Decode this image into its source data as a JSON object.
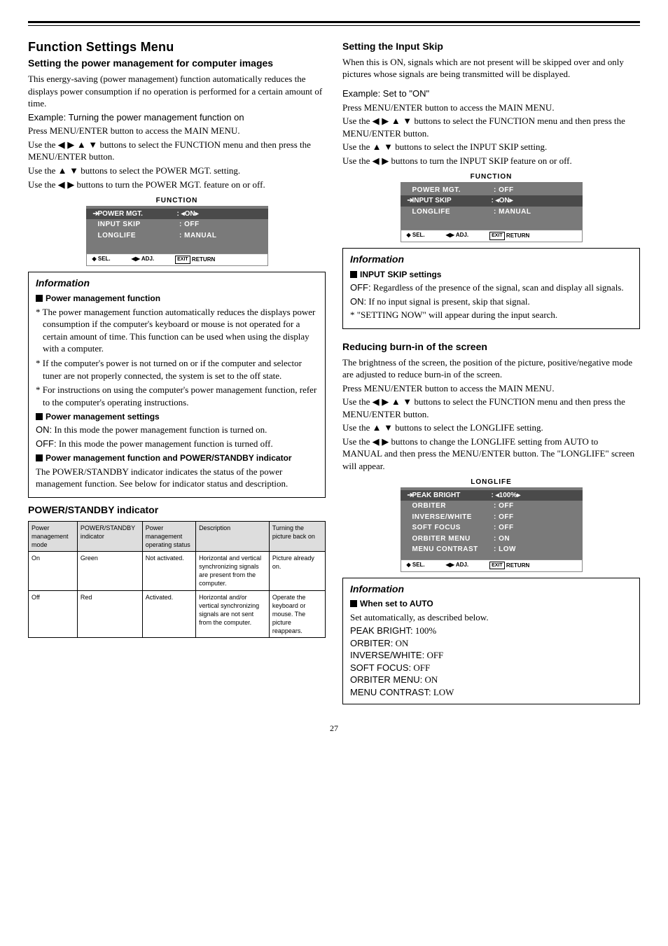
{
  "pageNumber": "27",
  "left": {
    "h1": "Function Settings Menu",
    "h2a": "Setting the power management for computer images",
    "p1": "This energy-saving (power management) function automatically reduces the displays power consumption if no operation is performed for a certain amount of time.",
    "ex1": "Example: Turning the power management function on",
    "p2": "Press MENU/ENTER button to access the MAIN MENU.",
    "p3a": "Use the ",
    "p3b": " buttons to select the FUNCTION menu and then press the MENU/ENTER button.",
    "p4a": "Use the ",
    "p4b": " buttons to select the POWER MGT. setting.",
    "p5a": "Use the ",
    "p5b": " buttons to turn the POWER MGT. feature on or off.",
    "osd1": {
      "title": "FUNCTION",
      "rows": [
        {
          "label": "POWER MGT.",
          "val": ": ◂ON▸",
          "hl": true
        },
        {
          "label": "INPUT SKIP",
          "val": ":   OFF"
        },
        {
          "label": "LONGLIFE",
          "val": ":   MANUAL"
        }
      ],
      "footer": {
        "sel": "◆ SEL.",
        "adj": "◀▶ ADJ.",
        "ret": "RETURN"
      }
    },
    "info1": {
      "heading": "Information",
      "sub1": "Power management function",
      "b1": "* The power management function automatically reduces the displays power consumption if the computer's keyboard or mouse is not operated for a certain amount of time. This function can be used when using the display with a computer.",
      "b2": "* If the computer's power is not turned on or if the computer and selector tuner are not properly connected, the system is set to the off state.",
      "b3": "* For instructions on using the computer's power management function, refer to the computer's operating instructions.",
      "sub2": "Power management settings",
      "on_label": "ON:",
      "on": " In this mode the power management function is turned on.",
      "off_label": "OFF:",
      "off": " In this mode the power management function is turned off.",
      "sub3": "Power management function and POWER/STANDBY indicator",
      "p": "The POWER/STANDBY indicator indicates the status of the power management function. See below for indicator status and description."
    },
    "tableHeading": "POWER/STANDBY indicator",
    "table": {
      "headers": [
        "Power management mode",
        "POWER/STANDBY indicator",
        "Power management operating status",
        "Description",
        "Turning the picture back on"
      ],
      "rows": [
        [
          "On",
          "Green",
          "Not activated.",
          "Horizontal and vertical synchronizing signals are present from the computer.",
          "Picture already on."
        ],
        [
          "Off",
          "Red",
          "Activated.",
          "Horizontal and/or vertical synchronizing signals are not sent from the computer.",
          "Operate the keyboard or mouse. The picture reappears."
        ]
      ]
    }
  },
  "right": {
    "h2a": "Setting the Input Skip",
    "p1": "When this is ON, signals which are not present will be skipped over and only pictures whose signals are being transmitted will be displayed.",
    "ex1": "Example: Set to \"ON\"",
    "p2": "Press MENU/ENTER button to access the MAIN MENU.",
    "p3a": "Use the ",
    "p3b": " buttons to select the FUNCTION menu and then press the MENU/ENTER button.",
    "p4a": "Use the ",
    "p4b": " buttons to select the INPUT SKIP setting.",
    "p5a": "Use the ",
    "p5b": " buttons to turn the INPUT SKIP feature on or off.",
    "osd1": {
      "title": "FUNCTION",
      "rows": [
        {
          "label": "POWER MGT.",
          "val": ":   OFF"
        },
        {
          "label": "INPUT SKIP",
          "val": ": ◂ON▸",
          "hl": true
        },
        {
          "label": "LONGLIFE",
          "val": ":   MANUAL"
        }
      ],
      "footer": {
        "sel": "◆ SEL.",
        "adj": "◀▶ ADJ.",
        "ret": "RETURN"
      }
    },
    "info1": {
      "heading": "Information",
      "sub1": "INPUT SKIP settings",
      "off_label": "OFF:",
      "off": " Regardless of the presence of the signal, scan and display all signals.",
      "on_label": "ON:",
      "on": " If no input signal is present, skip that signal.",
      "note": "* \"SETTING NOW\" will appear during the input search."
    },
    "h2b": "Reducing burn-in of the screen",
    "p6": "The brightness of the screen, the position of the picture, positive/negative mode are adjusted to reduce burn-in of the screen.",
    "p7": "Press MENU/ENTER button to access the MAIN MENU.",
    "p8a": "Use the ",
    "p8b": " buttons to select the FUNCTION menu and then press the MENU/ENTER button.",
    "p9a": "Use the ",
    "p9b": " buttons to select the LONGLIFE setting.",
    "p10a": "Use the ",
    "p10b": " buttons to change the LONGLIFE setting from AUTO to MANUAL and then press the MENU/ENTER button. The \"LONGLIFE\" screen will appear.",
    "osd2": {
      "title": "LONGLIFE",
      "rows": [
        {
          "label": "PEAK BRIGHT",
          "val": ": ◂100%▸",
          "hl": true
        },
        {
          "label": "ORBITER",
          "val": ":   OFF"
        },
        {
          "label": "INVERSE/WHITE",
          "val": ":   OFF"
        },
        {
          "label": "SOFT FOCUS",
          "val": ":   OFF"
        },
        {
          "label": "ORBITER MENU",
          "val": ":   ON"
        },
        {
          "label": "MENU CONTRAST",
          "val": ":   LOW"
        }
      ],
      "footer": {
        "sel": "◆ SEL.",
        "adj": "◀▶ ADJ.",
        "ret": "RETURN"
      }
    },
    "info2": {
      "heading": "Information",
      "sub1": "When set to AUTO",
      "p": "Set automatically, as described below.",
      "items": [
        {
          "k": "PEAK BRIGHT:",
          "v": " 100%"
        },
        {
          "k": "ORBITER:",
          "v": " ON"
        },
        {
          "k": "INVERSE/WHITE:",
          "v": " OFF"
        },
        {
          "k": "SOFT FOCUS:",
          "v": " OFF"
        },
        {
          "k": "ORBITER MENU:",
          "v": " ON"
        },
        {
          "k": "MENU CONTRAST:",
          "v": " LOW"
        }
      ]
    }
  },
  "arrows": {
    "lr": "◀ ▶",
    "ud": "▲ ▼",
    "all": "◀ ▶ ▲ ▼"
  },
  "exitLabel": "EXIT"
}
